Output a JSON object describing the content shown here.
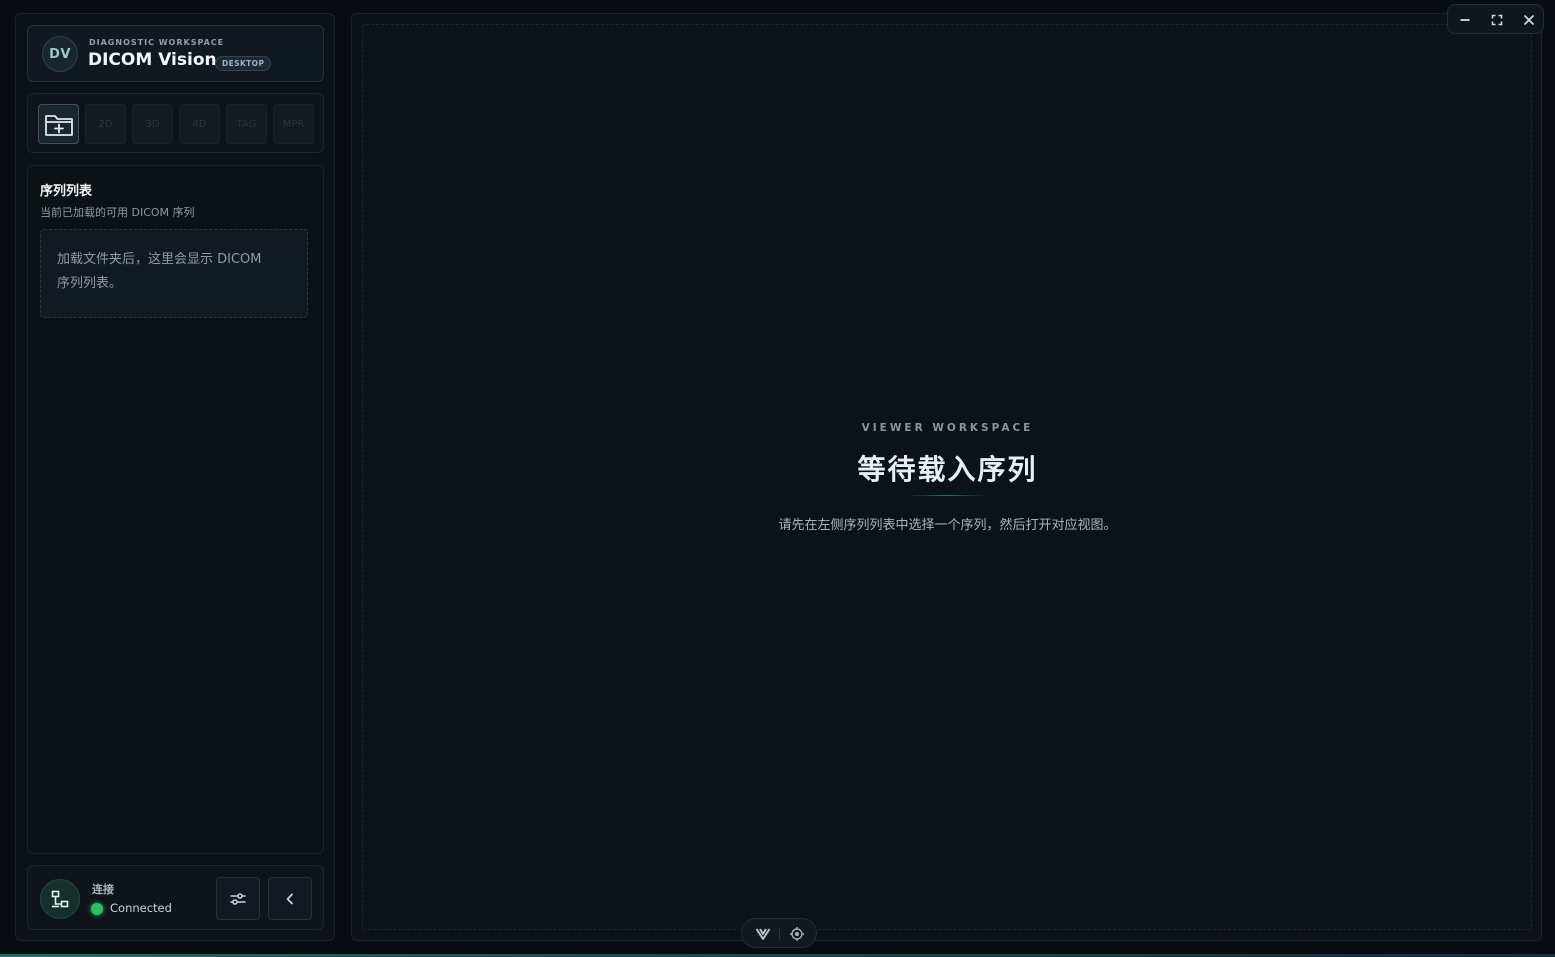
{
  "brand": {
    "avatar": "DV",
    "eyebrow": "DIAGNOSTIC WORKSPACE",
    "title": "DICOM Vision",
    "badge": "DESKTOP"
  },
  "toolbar": {
    "open_folder_icon": "folder-plus-icon",
    "buttons": [
      "2D",
      "3D",
      "4D",
      "TAG",
      "MPR"
    ]
  },
  "series": {
    "title": "序列列表",
    "subtitle": "当前已加载的可用 DICOM 序列",
    "empty_line1": "加载文件夹后，这里会显示 DICOM",
    "empty_line2": "序列列表。"
  },
  "connection": {
    "label": "连接",
    "status": "Connected",
    "status_color": "#2fbf63",
    "icons": [
      "network-icon",
      "sliders-icon",
      "chevron-left-icon"
    ]
  },
  "viewer": {
    "eyebrow": "VIEWER WORKSPACE",
    "title": "等待载入序列",
    "description": "请先在左侧序列列表中选择一个序列，然后打开对应视图。"
  },
  "window_controls": [
    "minimize-icon",
    "maximize-icon",
    "close-icon"
  ],
  "dock": [
    "v-logo-icon",
    "crosshair-icon"
  ]
}
